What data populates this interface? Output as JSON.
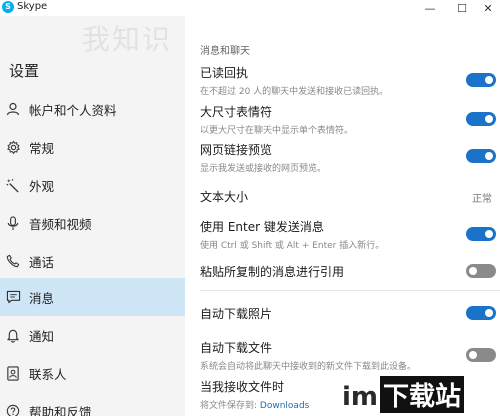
{
  "window": {
    "title": "Skype",
    "app_icon_letter": "S",
    "min_label": "—",
    "max_label": "☐",
    "close_label": "✕"
  },
  "watermark_text": "我知识",
  "sidebar": {
    "title": "设置",
    "items": [
      {
        "label": "帐户和个人资料",
        "icon": "person-icon"
      },
      {
        "label": "常规",
        "icon": "gear-icon"
      },
      {
        "label": "外观",
        "icon": "magic-wand-icon"
      },
      {
        "label": "音频和视频",
        "icon": "microphone-icon"
      },
      {
        "label": "通话",
        "icon": "phone-icon"
      },
      {
        "label": "消息",
        "icon": "message-icon",
        "active": true
      },
      {
        "label": "通知",
        "icon": "bell-icon"
      },
      {
        "label": "联系人",
        "icon": "contacts-icon"
      },
      {
        "label": "帮助和反馈",
        "icon": "help-icon"
      }
    ]
  },
  "main": {
    "section_title": "消息和聊天",
    "settings": [
      {
        "label": "已读回执",
        "desc": "在不超过 20 人的聊天中发送和接收已读回执。",
        "toggle": "on"
      },
      {
        "label": "大尺寸表情符",
        "desc": "以更大尺寸在聊天中显示单个表情符。",
        "toggle": "on"
      },
      {
        "label": "网页链接预览",
        "desc": "显示我发送或接收的网页预览。",
        "toggle": "on"
      },
      {
        "label": "文本大小",
        "value": "正常"
      },
      {
        "label": "使用 Enter 键发送消息",
        "desc": "使用 Ctrl 或 Shift 或 Alt + Enter 插入新行。",
        "toggle": "on"
      },
      {
        "label": "粘贴所复制的消息进行引用",
        "toggle": "off"
      },
      {
        "label": "自动下载照片",
        "toggle": "on"
      },
      {
        "label": "自动下载文件",
        "desc": "系统会自动将此聊天中接收到的新文件下载到此设备。",
        "toggle": "off"
      },
      {
        "label": "当我接收文件时",
        "desc_prefix": "将文件保存到:",
        "desc_link": "Downloads"
      }
    ]
  },
  "brand_watermark": {
    "part1": "im",
    "part2": "下载站"
  },
  "colors": {
    "toggle_on": "#1a73c9",
    "toggle_off": "#8a8a8a",
    "active_nav": "#cfe6f7",
    "sidebar_bg": "#f4f4f4",
    "link": "#1f6fb5"
  }
}
